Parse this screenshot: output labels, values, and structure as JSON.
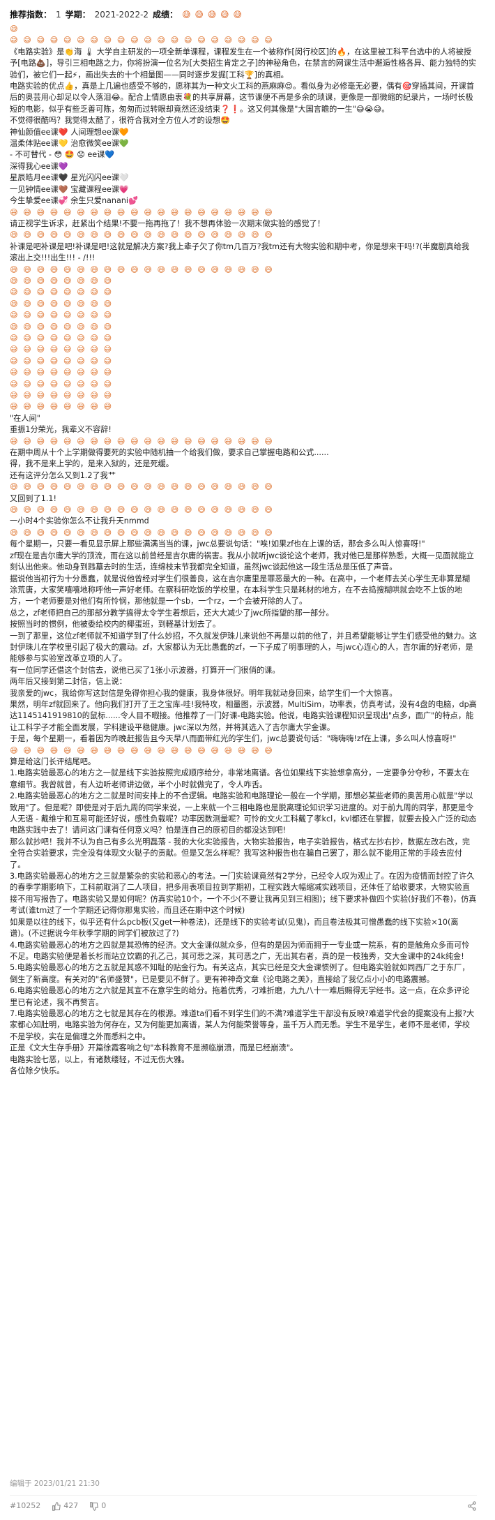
{
  "header": {
    "rec_label": "推荐指数：",
    "rec_value": "1",
    "term_label": "学期：",
    "term_value": "2021-2022-2",
    "grade_label": "成绩：",
    "grade_value": "😅 😅 😅 😅 😅"
  },
  "body": [
    "😅",
    "😅 😅 😅 😅 😅 😅 😅 😅 😅 😅 😅 😅 😅 😅 😅 😅 😅 😅 😅 😅",
    "《电路实验》是👏海 🌡 大学自主研发的一项全新单课程，课程发生在一个被称作[闵行校区]的🔥，在这里被工科平台选中的人将被授予[电路💩]，导引三相电路之力，你将扮演一位名为[大类招生肯定之子]的神秘角色，在禁言的网课生活中邂逅性格各异、能力独特的实验们，被它们一起⚡，画出失去的十个相量图——同时逐步发掘[工科🏆]的真相。",
    "电路实验的优点👍，真是上几遍也感受不够的，愿称其为一种文火工科的燕麻麻😍。看似身为必修毫无必要，偶有🎯穿插其间，开课首后的奥芸用心却足以令人落泪😂。配合上情愿由衷💐的共享屏幕，这节课便不再是多余的琐课，更像是一部微缩的纪录片，一场时长极短的电影，似乎有些乏善可陈，匆匆而过转眼却竟然还没结束❓❗。这又何其像是\"大国言瞻的一生\"😅😭😅。",
    "不觉得很酷吗？我觉得太酷了，很符合我对全方位人才的设想🤩",
    "神仙颜值ee课❤️ 人间理想ee课🧡",
    "温柔体贴ee课💛 治愈微笑ee课💚",
    "- 不可替代 - 😳 🤩 😟 ee课💙",
    "深得我心ee课💜",
    "星辰皓月ee课🖤 星光闪闪ee课🤍",
    "一见钟情ee课🤎 宝藏课程ee课💗",
    "今生挚爱ee课💞 余生只爱nanani💕",
    "😅 😅 😅 😅 😅 😅 😅 😅 😅 😅 😅 😅 😅 😅 😅 😅 😅 😅 😅 😅",
    "请正视学生诉求，赶紧出个结果!不要一拖再拖了！我不想再体验一次期末做实验的感觉了！",
    "😅 😅 😅 😅 😅 😅 😅 😅 😅 😅 😅 😅 😅 😅 😅 😅 😅 😅 😅 😅",
    "补课是吧补课是吧!补课是吧!这就是解决方案?我上辈子欠了你tm几百万?我tm还有大物实验和期中考，你是想来干吗!?(半魔剧真给我滚出上交!!!出生!!! - /!!!",
    "😅 😅 😅 😅 😅 😅 😅 😅 😅 😅 😅 😅 😅 😅 😅 😅 😅 😅 😅 😅",
    "😅 😅 😅 😅 😅 😅 😅 😅",
    "😅 😅 😅 😅 😅 😅 😅 😅",
    "😅 😅 😅 😅 😅 😅 😅 😅",
    "😅 😅 😅 😅 😅 😅 😅 😅",
    "😅 😅 😅 😅 😅 😅 😅 😅",
    "😅 😅 😅 😅 😅 😅 😅 😅",
    "😅 😅 😅 😅 😅 😅 😅 😅",
    "😅 😅 😅 😅 😅 😅 😅 😅",
    "😅 😅 😅 😅 😅 😅 😅 😅",
    "😅 😅 😅 😅 😅 😅 😅 😅",
    "😅 😅 😅 😅 😅 😅 😅 😅",
    "😅 😅 😅 😅 😅 😅 😅 😅",
    "\"在人间\"",
    "重振1分荣光，我辈义不容辞!",
    "😅 😅 😅 😅 😅 😅 😅 😅 😅 😅 😅 😅 😅 😅 😅 😅 😅 😅 😅 😅",
    "在期中周从十个上学期做得要死的实验中随机抽一个给我们做，要求自己掌握电路和公式......",
    "得，我不是来上学的，是来入狱的，还是死缓。",
    "还有这评分怎么又到1.2了我艹",
    "😅 😅 😅 😅 😅 😅 😅 😅 😅 😅 😅 😅 😅 😅 😅 😅 😅 😅 😅 😅",
    "又回到了1.1!",
    "😅 😅 😅 😅 😅 😅 😅 😅 😅 😅 😅 😅 😅 😅 😅 😅 😅 😅 😅 😅",
    "一小时4个实验你怎么不让我升天nmmd",
    "😅 😅 😅 😅 😅 😅 😅 😅 😅 😅 😅 😅 😅 😅 😅 😅 😅 😅 😅 😅",
    "每个星期一，只要一看见显示屏上那些满满当当的课，jwc总要说句话：\"唉!如果zf也在上课的话，那会多么叫人惊喜呀!\"",
    "zf现在是吉尔庸大学的顶流，而在这以前曾经是吉尔庸的祸害。我从小就听jwc谈论这个老师，我对他已是那样熟悉，大概一见面就能立刻认出他来。他动身到韪墓去时的生活，连绵枝末节我都完全知道，虽然jwc谈起他这一段生活总是压低了声音。",
    "据说他当初行为十分愚蠢，就是说他曾经对学生们很善良，这在吉尔庸里是罪恶最大的一种。在高中，一个老师去关心学生无非算是糊涂荒唐，大家笑嘻嘻地称呼他一声好老师。在察科研吃饭的学校里，在本科学生只是耗材的地方，在不去捣搜糊哄就会吃不上饭的地方，一个老师要是对他们有所怜悯，那他就是一个sb，一个rz，一个会被开除的人了。",
    "总之，zf老师把自己的那部分教学搞得太令学生着想后，还大大减少了jwc所指望的那一部分。",
    "按照当时的惯例，他被委给校内的椰蛋班，到軽基计划去了。",
    "一到了那里，这位zf老师就不知道学到了什么妙招，不久就发伊珠儿来说他不再是以前的他了，并且希望能够让学生们感受他的魅力。这封伊珠儿在学校里引起了极大的震动。zf，大家都认为无比愚蠢的zf，一下子成了明事理的人，与jwc心连心的人，吉尔庸的好老师，是能够参与实验室改革立项的人了。",
    "有一位同学还借这个封信去，说他已买了1张小示波器，打算开一门很俏的课。",
    "两年后又接到第二封信，信上说：",
    "我亲爱的jwc，我给你写这封信是免得你担心我的健康，我身体很好。明年我就动身回来，给学生们一个大惊喜。",
    "果然，明年zf就回来了。他向我们打开了王之宝库-哇!我特攻，相量图，示波器，MultiSim，功率表，仿真考试，没有4盘的电脑，dp高达1145141919810的鼠标......令人目不暇接。他推荐了一门好课-电路实验。他说，电路实验课程知识呈现出\"点多，面广\"的特点，能让工科学子才能全面发展，学科建设平稳健康。jwc深以为然，并将其选入了吉尔庸大学金课。",
    "于是，每个星期一，看着因为昨晚赶报告且今天早八而面带红光的学生们，jwc总要说句话：\"嗨嗨嗨!zf在上课，多么叫人惊喜呀!\"",
    "😅 😅 😅 😅 😅 😅 😅 😅 😅 😅 😅 😅 😅 😅 😅 😅 😅 😅 😅 😅",
    "算是给这门长评结尾吧。",
    "1.电路实验最恶心的地方之一就是线下实验按照完成顺序给分，非常地离谱。各位如果线下实验想拿高分，一定要争分夺秒，不要太在意细节。我曾就曾，有人边听老师讲边做，半个小时就做完了，令人咋舌。",
    "2.电路实验最恶心的地方之二就是时间安排上的不合逻辑。电路实验和电路理论一般在一个学期，那想必某些老师的奥苦用心就是\"学以致用\"了。但是呢？即使是对于后九周的同学来说，一上来就一个三相电路也是脱离理论知识学习进度的。对于前九周的同学，那更是令人无语 - 戴维宁和互易可能还好说，感性负载呢？功率因数测量呢？可怜的文火工科戴了孝kcl，kvl都还在掌握，就要去投入广泛的动态电路实践中去了！请问这门课有任何意义吗？怕是连自己的原初目的都没达到吧!",
    "那么就抄吧！我并不认为自己有多么光明磊落 - 我的大化实验报告，大物实验报告，电子实验报告，格式左抄右抄，数据左改右改，完全符合实验要求，完全没有体现文火鞑子的贡献。但是又怎么样呢？我写这种报告也在骗自己罢了，那么就不能用正常的手段去应付了。",
    "3.电路实验最恶心的地方之三就是繁杂的实验和恶心的考法。一门实验课竟然有2学分，已经令人叹为观止了。在因为疫情而封控了许久的春季学期影响下，工科前取消了二人项目，把多用表项目拉到学期初，工程实践大幅缩减实践项目，还体任了给收要求，大物实验直接不用写报告了。电路实验又是如何呢？仿真实验10个，一个不少(不要让我再见到三相图)；线下要求补做四个实验(好我们不卷)，仿真考试(谁tm过了一个学期还记得你那鬼实验，而且还在期中这个时候)",
    "如果是以往的线下，似乎还有什么pcb板(又get一种卷法)，还是线下的实验考试(见鬼)，而且卷法极其可憎愚蠢的线下实验×10(离谱)。(不过据说今年秋季学期的同学们被放过了?)",
    "4.电路实验最恶心的地方之四就是其恐怖的经济。文大金课似就众多，但有的是因为师而拥于一专业或一院系，有的是触角众多而可怜不足。电路实验便是着长杉而站立饮霸的孔乙己，其可悲之深，其可恶之广，无出其右者，真的是一枝独秀，交大金课中的24k纯金!",
    "5.电路实验最恶心的地方之五就是其惑不知耻的贴金行为。有关这点，其实已经是交大金课惯例了。但电路实验就如同西厂之于东厂，倒生了新高度。有关对的\"名师盛赞\"，已是要见不鲜了。更有神神奇文章《论电路之美》，直接给了我亿点小小的电路震撼。",
    "6.电路实验最恶心的地方之六就是其宣不在意学生的给分。拖着优秀，刁难折磨，九九八十一难后赐得无学经书。这一点，在众多评论里已有论述，我不再赘言。",
    "7.电路实验最恶心的地方之七就是其存在的根源。难道ta们看不到学生们的不满?难道学生干部没有反映?难道学代会的提案没有上报?大家都心知肚明，电路实验为何存在，又为何能更加离谱，某人为何能荣誉等身，虽千万人而无悉。学生不是学生，老师不是老师，学校不是学校，实在是偏理之外而悉料之中。",
    "正是《文大生存手册》开篇徐霞客响之句\"本科教育不是濒临崩溃，而是已经崩溃\"。",
    "电路实验七恶，以上，有诸数缕轻，不过无伤大雅。",
    "各位除夕快乐。"
  ],
  "footer": {
    "edited": "编辑于 2023/01/21 21:30",
    "post_id": "#10252",
    "likes": "427",
    "dislikes": "0"
  }
}
